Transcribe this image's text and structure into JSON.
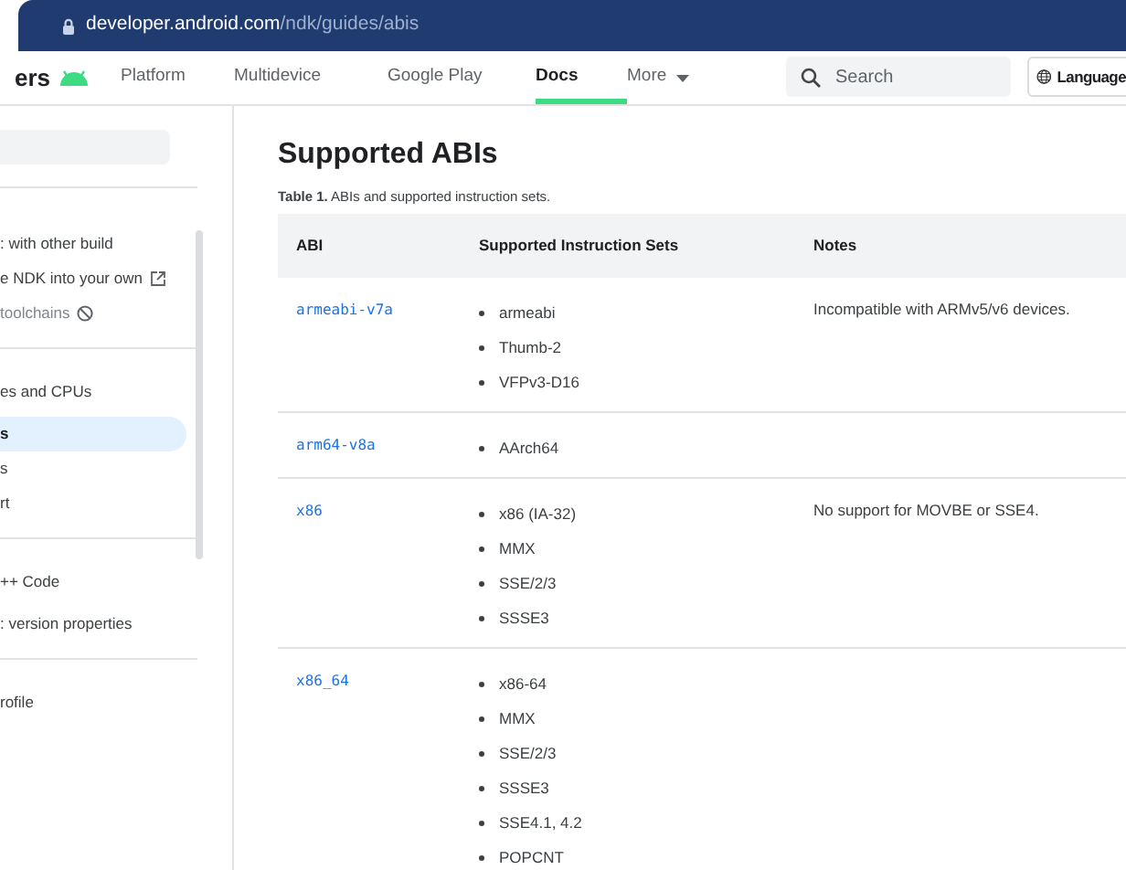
{
  "address_bar": {
    "domain": "developer.android.com",
    "path": "/ndk/guides/abis"
  },
  "nav": {
    "brand": "ers",
    "items": [
      {
        "label": "Platform",
        "selected": false
      },
      {
        "label": "Multidevice",
        "selected": false
      },
      {
        "label": "Google Play",
        "selected": false
      },
      {
        "label": "Docs",
        "selected": true
      },
      {
        "label": "More",
        "selected": false,
        "kind": "dropdown"
      }
    ],
    "search": {
      "placeholder": "Search"
    },
    "language": "Language"
  },
  "sidebar": {
    "items": [
      {
        "label": ": with other build",
        "selected": false,
        "kind": "item"
      },
      {
        "label": "e NDK into your own",
        "selected": false,
        "kind": "external"
      },
      {
        "label": "toolchains",
        "selected": false,
        "kind": "deprecated"
      },
      {
        "kind": "divider"
      },
      {
        "label": "es and CPUs",
        "selected": false,
        "kind": "heading"
      },
      {
        "label": "s",
        "selected": true,
        "kind": "item"
      },
      {
        "label": "s",
        "selected": false,
        "kind": "item"
      },
      {
        "label": "rt",
        "selected": false,
        "kind": "item"
      },
      {
        "kind": "divider"
      },
      {
        "label": "++ Code",
        "selected": false,
        "kind": "heading"
      },
      {
        "label": ": version properties",
        "selected": false,
        "kind": "item"
      },
      {
        "kind": "divider"
      },
      {
        "label": "rofile",
        "selected": false,
        "kind": "heading"
      }
    ]
  },
  "page": {
    "title": "Supported ABIs",
    "caption": "**Table 1.** ABIs and supported instruction sets.",
    "table": {
      "columns": [
        "ABI",
        "Supported Instruction Sets",
        "Notes"
      ],
      "rows": [
        {
          "abi": "armeabi-v7a",
          "sets": [
            "armeabi",
            "Thumb-2",
            "VFPv3-D16"
          ],
          "notes": "Incompatible with ARMv5/v6 devices."
        },
        {
          "abi": "arm64-v8a",
          "sets": [
            "AArch64"
          ]
        },
        {
          "abi": "x86",
          "sets": [
            "x86 (IA-32)",
            "MMX",
            "SSE/2/3",
            "SSSE3"
          ],
          "notes": "No support for MOVBE or SSE4."
        },
        {
          "abi": "x86_64",
          "sets": [
            "x86-64",
            "MMX",
            "SSE/2/3",
            "SSSE3",
            "SSE4.1, 4.2",
            "POPCNT"
          ]
        }
      ]
    }
  }
}
